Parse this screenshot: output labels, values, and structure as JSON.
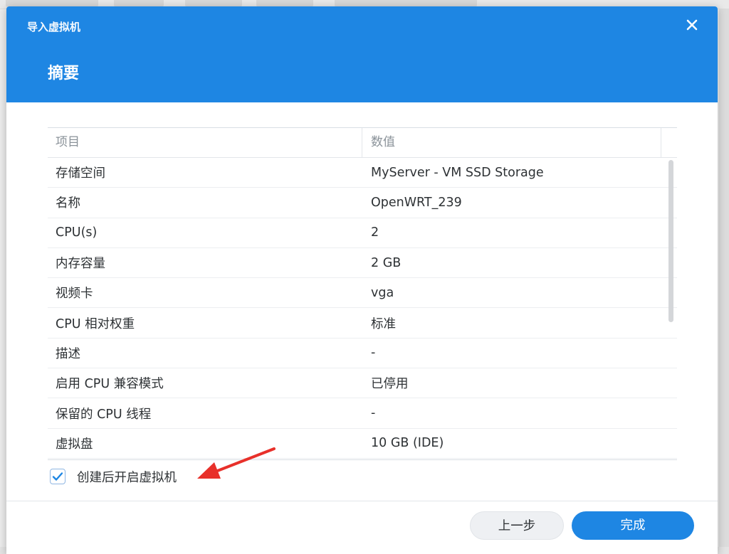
{
  "dialog": {
    "window_title": "导入虚拟机",
    "step_title": "摘要",
    "close_icon": "close-icon"
  },
  "table": {
    "headers": [
      "项目",
      "数值"
    ],
    "rows": [
      {
        "item": "存储空间",
        "value": "MyServer - VM SSD Storage"
      },
      {
        "item": "名称",
        "value": "OpenWRT_239"
      },
      {
        "item": "CPU(s)",
        "value": "2"
      },
      {
        "item": "内存容量",
        "value": "2 GB"
      },
      {
        "item": "视频卡",
        "value": "vga"
      },
      {
        "item": "CPU 相对权重",
        "value": "标准"
      },
      {
        "item": "描述",
        "value": "-"
      },
      {
        "item": "启用 CPU 兼容模式",
        "value": "已停用"
      },
      {
        "item": "保留的 CPU 线程",
        "value": "-"
      },
      {
        "item": "虚拟盘",
        "value": "10 GB (IDE)"
      }
    ]
  },
  "options": {
    "start_after_create_label": "创建后开启虚拟机",
    "start_after_create_checked": true
  },
  "buttons": {
    "back_label": "上一步",
    "finish_label": "完成"
  },
  "colors": {
    "accent": "#1e86e3",
    "annotation_arrow": "#e8302a"
  }
}
